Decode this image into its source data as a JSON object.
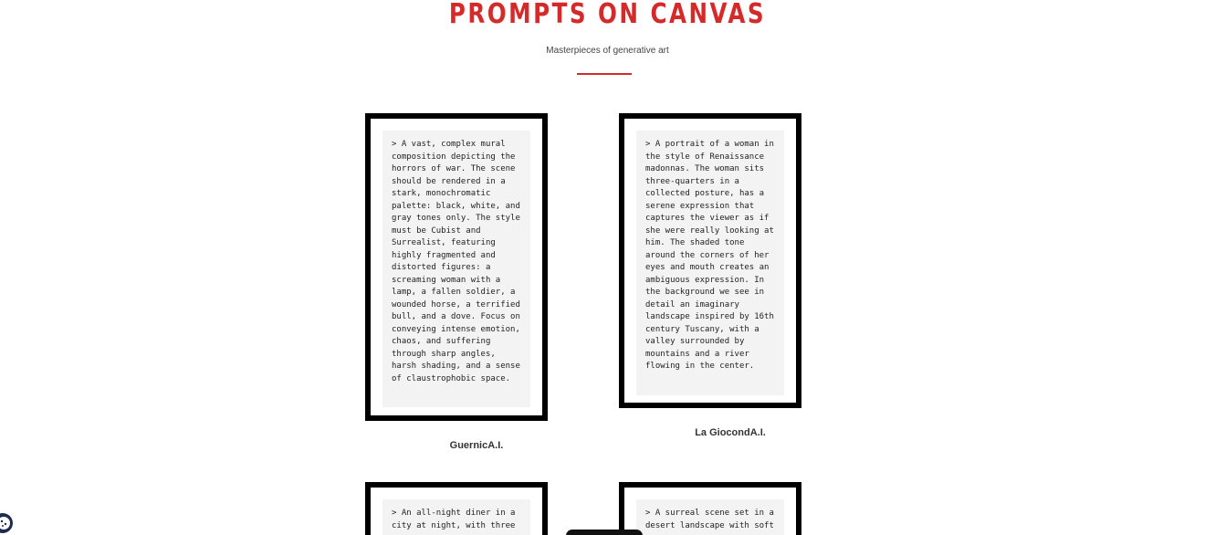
{
  "header": {
    "title": "PROMPTS ON CANVAS",
    "subtitle": "Masterpieces of generative art"
  },
  "colors": {
    "accent": "#d42a2a",
    "frame": "#000000",
    "canvas_bg": "#f3f3f3"
  },
  "artworks": [
    {
      "prompt": "> A vast, complex mural composition depicting the horrors of war. The scene should be rendered in a stark, monochromatic palette: black, white, and gray tones only. The style must be Cubist and Surrealist, featuring highly fragmented and distorted figures: a screaming woman with a lamp, a fallen soldier, a wounded horse, a terrified bull, and a dove. Focus on conveying intense emotion, chaos, and suffering through sharp angles, harsh shading, and a sense of claustrophobic space.",
      "title": "GuernicA.I."
    },
    {
      "prompt": "> A portrait of a woman in the style of Renaissance madonnas. The woman sits three-quarters in a collected posture, has a serene expression that captures the viewer as if she were really looking at him. The shaded tone around the corners of her eyes and mouth creates an ambiguous expression. In the background we see in detail an imaginary landscape inspired by 16th century Tuscany, with a valley surrounded by mountains and a river flowing in the center.",
      "title": "La GiocondA.I."
    },
    {
      "prompt": "> An all-night diner in a city at night, with three",
      "title": ""
    },
    {
      "prompt": "> A surreal scene set in a desert landscape with soft",
      "title": ""
    }
  ],
  "icons": {
    "cookie": "cookie-icon"
  }
}
